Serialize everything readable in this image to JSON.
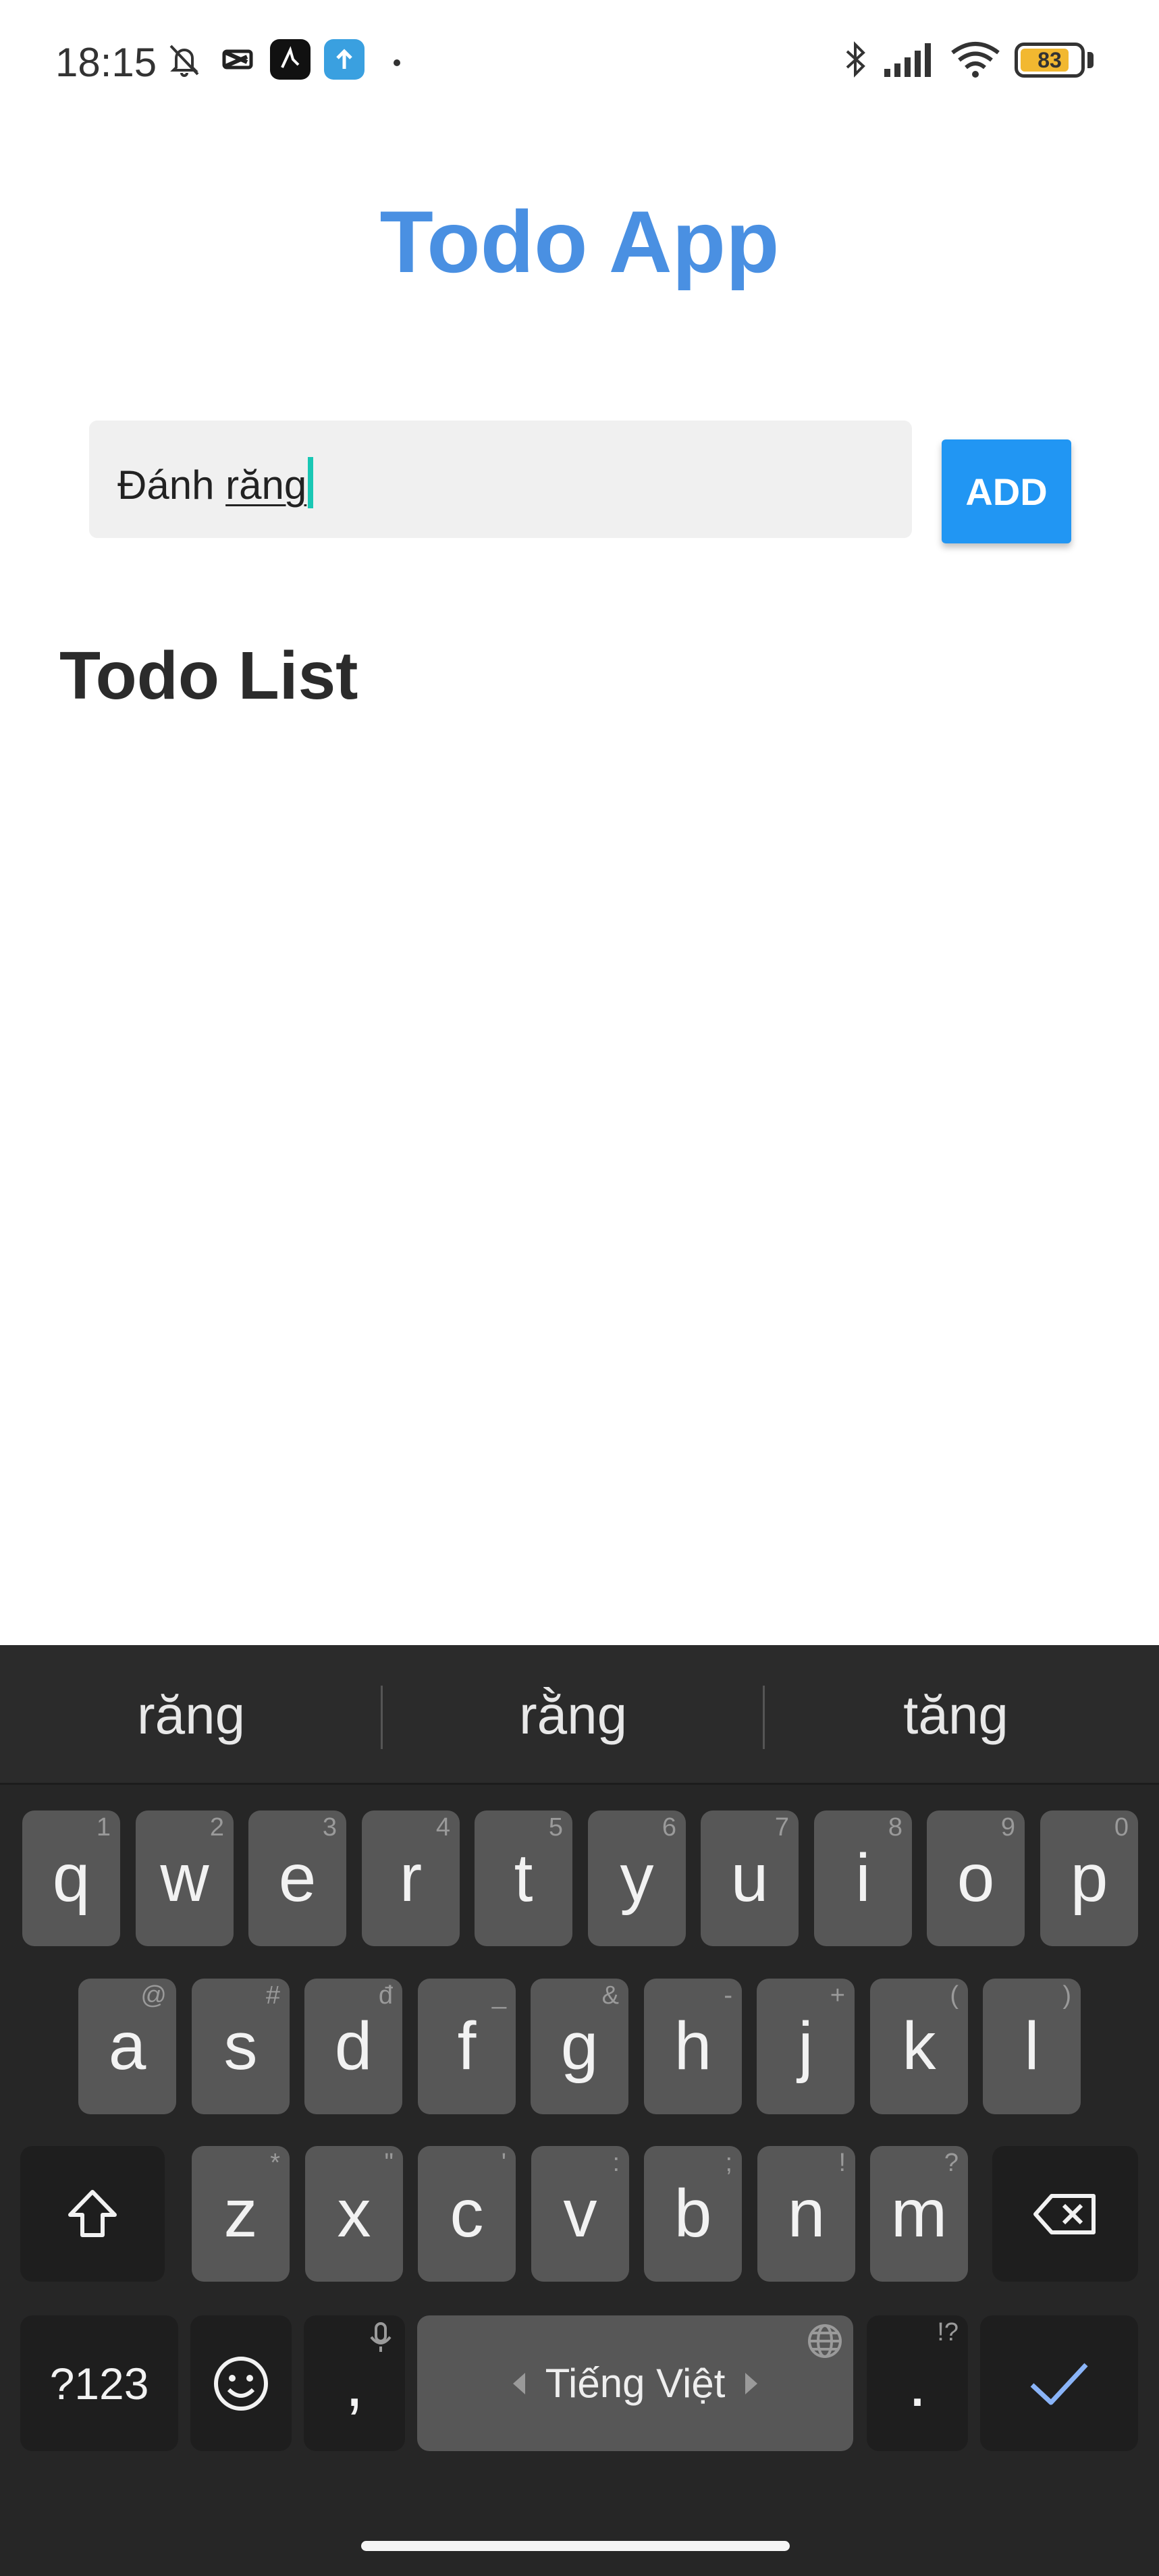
{
  "status_bar": {
    "time": "18:15",
    "battery_level": "83",
    "battery_fraction": 0.83,
    "icons": [
      "mute-bell-icon",
      "capcut-icon",
      "app-icon",
      "upload-app-icon",
      "notification-dot-icon",
      "bluetooth-icon",
      "signal-icon",
      "wifi-icon",
      "battery-icon"
    ]
  },
  "app": {
    "title": "Todo App",
    "input": {
      "committed_text": "Đánh ",
      "composing_text": "răng"
    },
    "add_button_label": "ADD",
    "list_title": "Todo List"
  },
  "keyboard": {
    "suggestions": [
      "răng",
      "rằng",
      "tăng"
    ],
    "row1": [
      {
        "key": "q",
        "hint": "1"
      },
      {
        "key": "w",
        "hint": "2"
      },
      {
        "key": "e",
        "hint": "3"
      },
      {
        "key": "r",
        "hint": "4"
      },
      {
        "key": "t",
        "hint": "5"
      },
      {
        "key": "y",
        "hint": "6"
      },
      {
        "key": "u",
        "hint": "7"
      },
      {
        "key": "i",
        "hint": "8"
      },
      {
        "key": "o",
        "hint": "9"
      },
      {
        "key": "p",
        "hint": "0"
      }
    ],
    "row2": [
      {
        "key": "a",
        "hint": "@"
      },
      {
        "key": "s",
        "hint": "#"
      },
      {
        "key": "d",
        "hint": "đ"
      },
      {
        "key": "f",
        "hint": "_"
      },
      {
        "key": "g",
        "hint": "&"
      },
      {
        "key": "h",
        "hint": "-"
      },
      {
        "key": "j",
        "hint": "+"
      },
      {
        "key": "k",
        "hint": "("
      },
      {
        "key": "l",
        "hint": ")"
      }
    ],
    "row3": [
      {
        "key": "z",
        "hint": "*"
      },
      {
        "key": "x",
        "hint": "\""
      },
      {
        "key": "c",
        "hint": "'"
      },
      {
        "key": "v",
        "hint": ":"
      },
      {
        "key": "b",
        "hint": ";"
      },
      {
        "key": "n",
        "hint": "!"
      },
      {
        "key": "m",
        "hint": "?"
      }
    ],
    "symbols_key": "?123",
    "comma_key": ",",
    "space_label": "Tiếng Việt",
    "period_key": ".",
    "period_hint": "!?",
    "accent_color": "#8ab4f8"
  }
}
